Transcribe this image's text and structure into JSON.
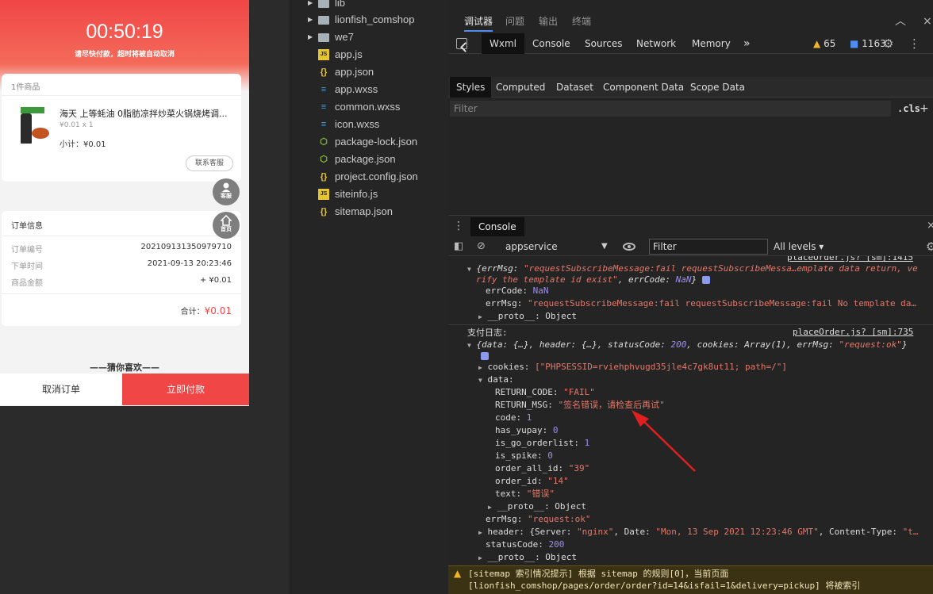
{
  "phone": {
    "timer": "00:50:19",
    "timer_tip": "请尽快付款，超时将被自动取消",
    "goods_count": "1件商品",
    "goods_title": "海天 上等蚝油 0脂肪凉拌炒菜火锅烧烤调...",
    "goods_spec": "¥0.01 x 1",
    "goods_subtotal": "小计：¥0.01",
    "contact_btn": "联系客服",
    "float_service": "客服",
    "float_home": "首页",
    "order_title": "订单信息",
    "order_rows": [
      {
        "label": "订单编号",
        "value": "202109131350979710"
      },
      {
        "label": "下单时间",
        "value": "2021-09-13 20:23:46"
      },
      {
        "label": "商品金额",
        "value": "+ ¥0.01"
      }
    ],
    "total_label": "合计：",
    "total_value": "¥0.01",
    "guess": "——猜你喜欢——",
    "cancel_btn": "取消订单",
    "pay_btn": "立即付款"
  },
  "filetree": [
    {
      "name": "lib",
      "type": "folder",
      "expandable": true
    },
    {
      "name": "lionfish_comshop",
      "type": "folder",
      "expandable": true
    },
    {
      "name": "we7",
      "type": "folder",
      "expandable": true
    },
    {
      "name": "app.js",
      "type": "js"
    },
    {
      "name": "app.json",
      "type": "json"
    },
    {
      "name": "app.wxss",
      "type": "css"
    },
    {
      "name": "common.wxss",
      "type": "css"
    },
    {
      "name": "icon.wxss",
      "type": "css"
    },
    {
      "name": "package-lock.json",
      "type": "pkg"
    },
    {
      "name": "package.json",
      "type": "pkg"
    },
    {
      "name": "project.config.json",
      "type": "json"
    },
    {
      "name": "siteinfo.js",
      "type": "js"
    },
    {
      "name": "sitemap.json",
      "type": "json"
    }
  ],
  "devtools": {
    "top_tabs": [
      "调试器",
      "问题",
      "输出",
      "终端"
    ],
    "panel_tabs": [
      "Wxml",
      "Console",
      "Sources",
      "Network",
      "Memory"
    ],
    "more": "»",
    "warn_count": "65",
    "msg_count": "1163",
    "style_tabs": [
      "Styles",
      "Computed",
      "Dataset",
      "Component Data",
      "Scope Data"
    ],
    "styles_filter": "Filter",
    "cls": ".cls",
    "plus": "+",
    "console_tab": "Console",
    "context": "appservice",
    "console_filter": "Filter",
    "levels": "All levels",
    "close": "×",
    "minimize": "︿"
  },
  "console": {
    "src1": "placeOrder.js? [sm]:1415",
    "obj1_a": "{errMsg: ",
    "obj1_b": "\"requestSubscribeMessage:fail requestSubscribeMessa…emplate data return, ve",
    "obj1_c": "rify the template id exist\"",
    "obj1_d": ", errCode: ",
    "obj1_e": "NaN",
    "obj1_f": "}",
    "errCode_k": "errCode: ",
    "errCode_v": "NaN",
    "errMsg_k": "errMsg: ",
    "errMsg_v": "\"requestSubscribeMessage:fail requestSubscribeMessage:fail No template da…",
    "proto": "__proto__",
    "proto_v": ": Object",
    "log_title": "支付日志:",
    "src2": "placeOrder.js? [sm]:735",
    "obj2_a": "{data: {…}, header: {…}, statusCode: ",
    "obj2_b": "200",
    "obj2_c": ", cookies: Array(1), errMsg: ",
    "obj2_d": "\"request:ok\"",
    "obj2_e": "}",
    "cookies_k": "cookies: ",
    "cookies_v": "[\"PHPSESSID=rviehphvugd35jle4c7gk8ut11; path=/\"]",
    "data_k": "data:",
    "return_code_k": "RETURN_CODE: ",
    "return_code_v": "\"FAIL\"",
    "return_msg_k": "RETURN_MSG: ",
    "return_msg_v": "\"签名错误，请检查后再试\"",
    "code_k": "code: ",
    "code_v": "1",
    "has_yupay_k": "has_yupay: ",
    "has_yupay_v": "0",
    "is_go_k": "is_go_orderlist: ",
    "is_go_v": "1",
    "is_spike_k": "is_spike: ",
    "is_spike_v": "0",
    "order_all_k": "order_all_id: ",
    "order_all_v": "\"39\"",
    "order_id_k": "order_id: ",
    "order_id_v": "\"14\"",
    "text_k": "text: ",
    "text_v": "\"错误\"",
    "errMsg2_k": "errMsg: ",
    "errMsg2_v": "\"request:ok\"",
    "header_a": "header: {Server: ",
    "header_b": "\"nginx\"",
    "header_c": ", Date: ",
    "header_d": "\"Mon, 13 Sep 2021 12:23:46 GMT\"",
    "header_e": ", Content-Type: ",
    "header_f": "\"t…",
    "status_k": "statusCode: ",
    "status_v": "200"
  },
  "warning": {
    "line1": "[sitemap 索引情况提示] 根据 sitemap 的规则[0]，当前页面",
    "line2": "[lionfish_comshop/pages/order/order?id=14&isfail=1&delivery=pickup] 将被索引"
  },
  "colors": {
    "accent": "#f04646",
    "devtools_bg": "#242424",
    "string": "#e3786a",
    "number": "#9c8ef0"
  }
}
